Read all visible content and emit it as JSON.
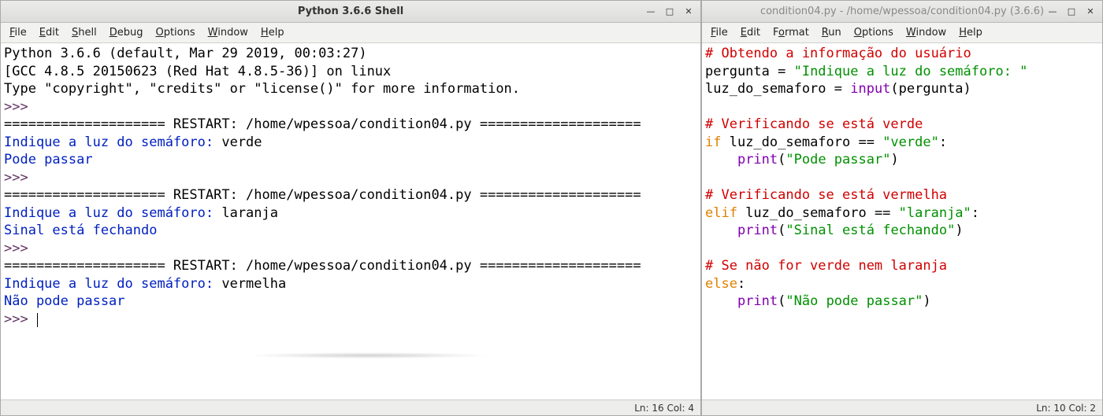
{
  "shell": {
    "title": "Python 3.6.6 Shell",
    "menus": [
      "File",
      "Edit",
      "Shell",
      "Debug",
      "Options",
      "Window",
      "Help"
    ],
    "menu_ul": [
      "F",
      "E",
      "S",
      "D",
      "O",
      "W",
      "H"
    ],
    "content": {
      "banner1": "Python 3.6.6 (default, Mar 29 2019, 00:03:27) ",
      "banner2": "[GCC 4.8.5 20150623 (Red Hat 4.8.5-36)] on linux",
      "banner3": "Type \"copyright\", \"credits\" or \"license()\" for more information.",
      "prompt": ">>> ",
      "restart": "==================== RESTART: /home/wpessoa/condition04.py ====================",
      "run1_prompt": "Indique a luz do semáforo: ",
      "run1_input": "verde",
      "run1_out": "Pode passar",
      "run2_prompt": "Indique a luz do semáforo: ",
      "run2_input": "laranja",
      "run2_out": "Sinal está fechando",
      "run3_prompt": "Indique a luz do semáforo: ",
      "run3_input": "vermelha",
      "run3_out": "Não pode passar"
    },
    "status": "Ln: 16  Col: 4"
  },
  "editor": {
    "title": "condition04.py - /home/wpessoa/condition04.py (3.6.6)",
    "menus": [
      "File",
      "Edit",
      "Format",
      "Run",
      "Options",
      "Window",
      "Help"
    ],
    "menu_ul": [
      "F",
      "E",
      "o",
      "R",
      "O",
      "W",
      "H"
    ],
    "code": {
      "l1_comment": "# Obtendo a informação do usuário",
      "l2_var": "pergunta = ",
      "l2_str": "\"Indique a luz do semáforo: \"",
      "l3_a": "luz_do_semaforo = ",
      "l3_b": "input",
      "l3_c": "(pergunta)",
      "l5_comment": "# Verificando se está verde",
      "l6_kw": "if",
      "l6_body": " luz_do_semaforo == ",
      "l6_str": "\"verde\"",
      "l6_colon": ":",
      "l7_indent": "    ",
      "l7_print": "print",
      "l7_paren": "(",
      "l7_str": "\"Pode passar\"",
      "l7_cparen": ")",
      "l9_comment": "# Verificando se está vermelha",
      "l10_kw": "elif",
      "l10_body": " luz_do_semaforo == ",
      "l10_str": "\"laranja\"",
      "l10_colon": ":",
      "l11_indent": "    ",
      "l11_print": "print",
      "l11_paren": "(",
      "l11_str": "\"Sinal está fechando\"",
      "l11_cparen": ")",
      "l13_comment": "# Se não for verde nem laranja",
      "l14_kw": "else",
      "l14_colon": ":",
      "l15_indent": "    ",
      "l15_print": "print",
      "l15_paren": "(",
      "l15_str": "\"Não pode passar\"",
      "l15_cparen": ")"
    },
    "status": "Ln: 10  Col: 2"
  },
  "win_controls": {
    "min": "—",
    "max": "□",
    "close": "✕"
  }
}
